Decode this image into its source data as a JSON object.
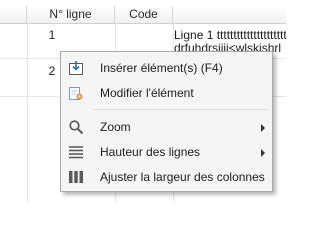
{
  "grid": {
    "columns": [
      {
        "label": ""
      },
      {
        "label": "N° ligne"
      },
      {
        "label": "Code"
      },
      {
        "label": ""
      }
    ],
    "rows": [
      {
        "num": "1",
        "text_line1": "Ligne 1 tttttttttttttttttttttttttt",
        "text_line2": "drfuhdrsiiii<wlskishrl"
      },
      {
        "num": "2"
      }
    ]
  },
  "context_menu": {
    "items": [
      {
        "label": "Insérer élément(s) (F4)",
        "icon": "insert-element-icon"
      },
      {
        "label": "Modifier l'élément",
        "icon": "edit-element-icon"
      },
      {
        "label": "Zoom",
        "icon": "magnifier-icon",
        "submenu": true
      },
      {
        "label": "Hauteur des lignes",
        "icon": "row-height-icon",
        "submenu": true
      },
      {
        "label": "Ajuster la largeur des colonnes",
        "icon": "column-width-icon"
      }
    ]
  },
  "colors": {
    "menu_background": "#f5f5f5",
    "menu_border": "#a8a8a8",
    "header_border": "#d0d0d0",
    "icon_blue": "#3a6ea5"
  }
}
